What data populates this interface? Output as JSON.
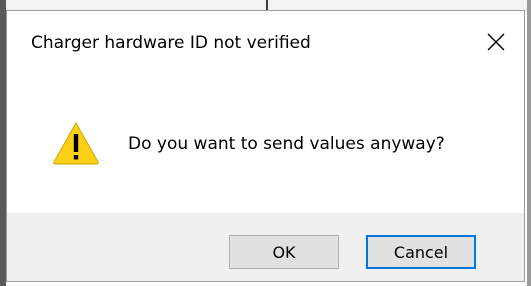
{
  "dialog": {
    "title": "Charger hardware ID not verified",
    "message": "Do you want to send values anyway?",
    "icon": "warning-icon",
    "buttons": {
      "ok_label": "OK",
      "cancel_label": "Cancel"
    },
    "close_icon": "close-icon"
  },
  "colors": {
    "footer_bg": "#f0f0f0",
    "button_bg": "#e1e1e1",
    "focus_border": "#0078d7",
    "warning_yellow": "#fcd116"
  }
}
